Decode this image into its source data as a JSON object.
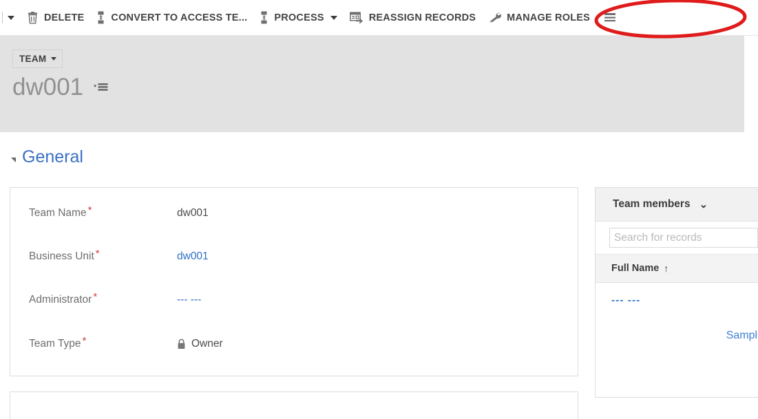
{
  "commandbar": {
    "overflow_caret_name": "more-commands-caret",
    "buttons": [
      {
        "label": "DELETE",
        "icon": "trash-icon",
        "has_caret": false
      },
      {
        "label": "CONVERT TO ACCESS TE...",
        "icon": "convert-team-icon",
        "has_caret": false
      },
      {
        "label": "PROCESS",
        "icon": "process-icon",
        "has_caret": true
      },
      {
        "label": "REASSIGN RECORDS",
        "icon": "reassign-records-icon",
        "has_caret": false
      },
      {
        "label": "MANAGE ROLES",
        "icon": "manage-roles-icon",
        "has_caret": false
      }
    ]
  },
  "header": {
    "breadcrumb_label": "TEAM",
    "record_title": "dw001",
    "form_selector_icon": "form-selector-icon"
  },
  "section": {
    "title": "General",
    "collapse_icon": "collapse-triangle-icon"
  },
  "form": {
    "fields": [
      {
        "label": "Team Name",
        "required": "*",
        "value": "dw001",
        "style": "text",
        "icon": ""
      },
      {
        "label": "Business Unit",
        "required": "*",
        "value": "dw001",
        "style": "link",
        "icon": ""
      },
      {
        "label": "Administrator",
        "required": "*",
        "value": "--- ---",
        "style": "link",
        "icon": ""
      },
      {
        "label": "Team Type",
        "required": "*",
        "value": "Owner",
        "style": "text",
        "icon": "lock-icon"
      }
    ]
  },
  "side_panel": {
    "title": "Team members",
    "chevron_icon": "chevron-down-icon",
    "search_placeholder": "Search for records",
    "search_value": "",
    "column_header": "Full Name",
    "sort_indicator": "↑",
    "rows": [
      {
        "full_name": "--- ---"
      }
    ],
    "sample_link": "Sample"
  },
  "annotation": {
    "shape": "red-ellipse-highlight",
    "target": "MANAGE ROLES",
    "color": "#e01b1b"
  },
  "colors": {
    "accent_link": "#2d6fc4",
    "section_title": "#3a70c4",
    "header_band": "#e2e2e2",
    "required_star": "#d1403f",
    "annotation_red": "#e01b1b"
  }
}
